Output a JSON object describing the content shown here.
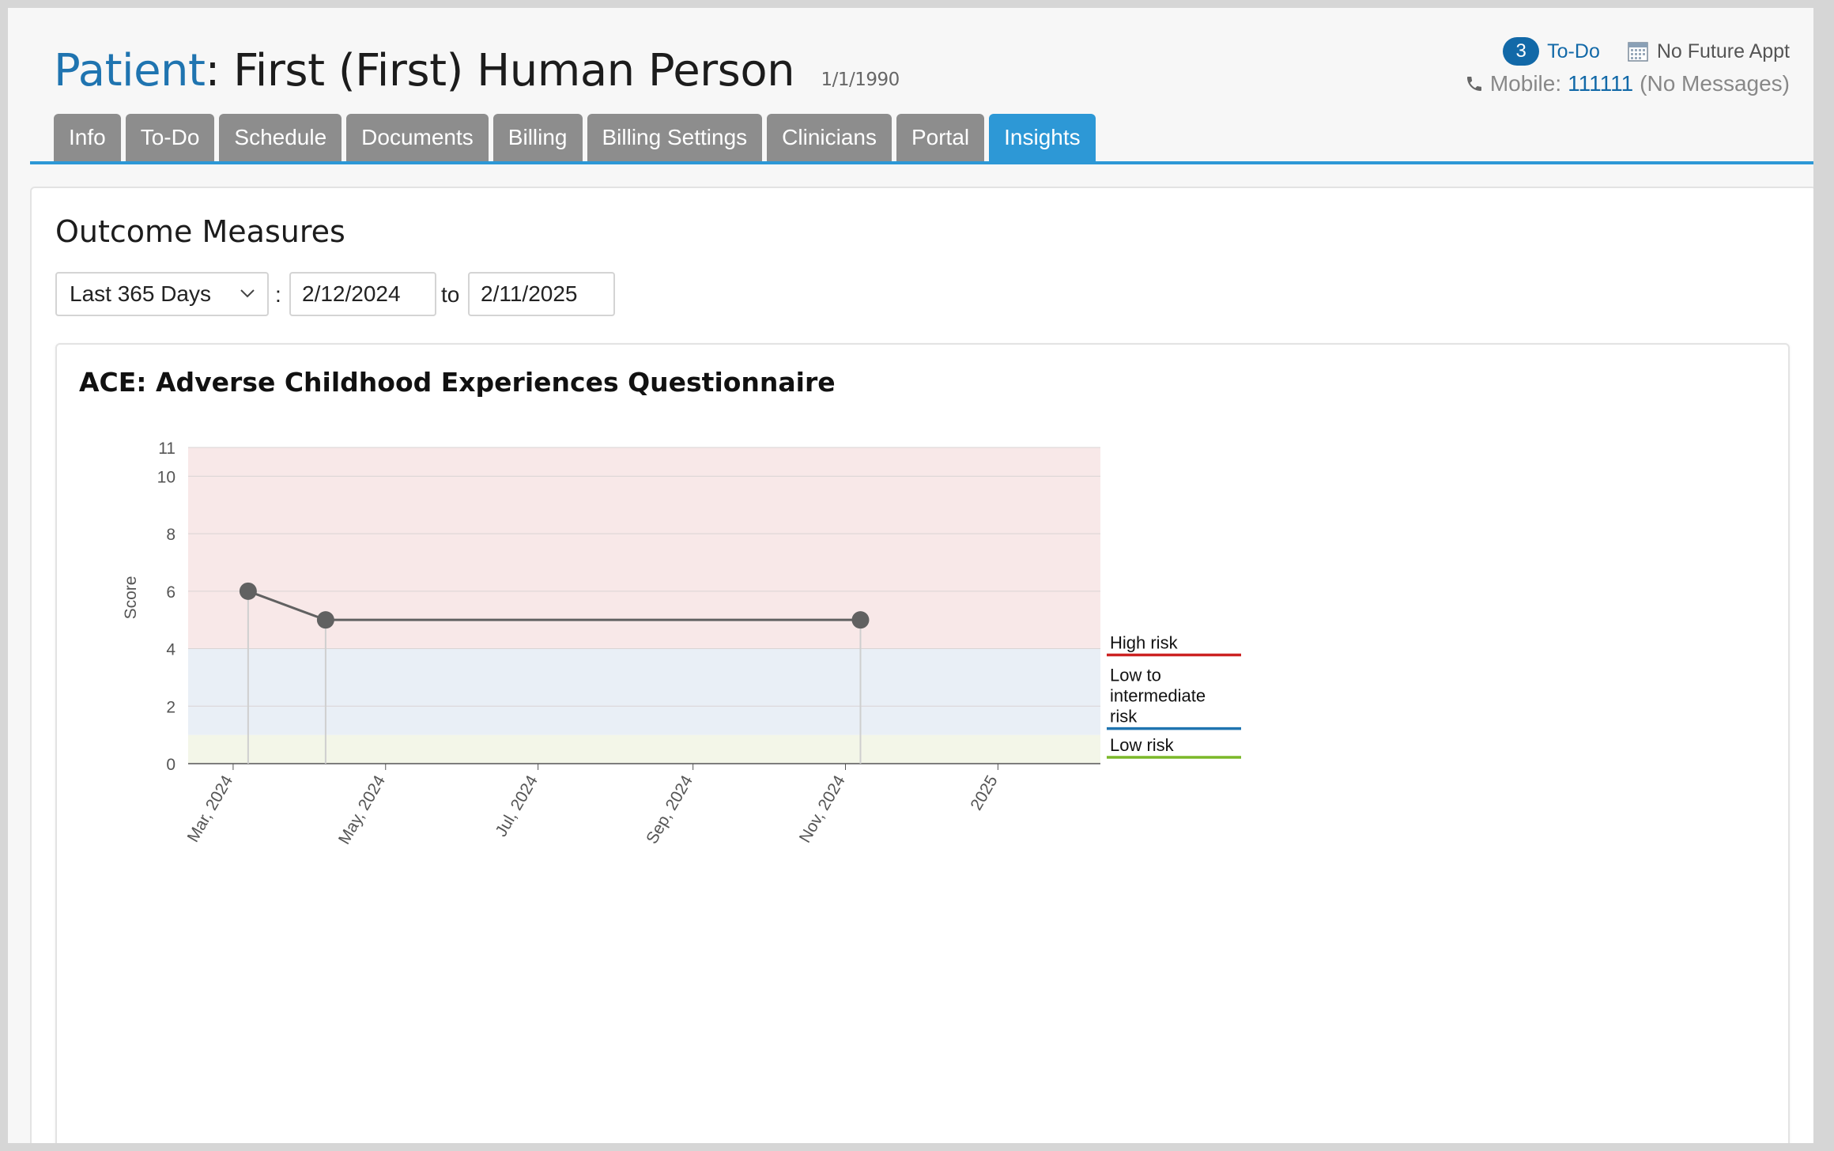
{
  "patient": {
    "label": "Patient",
    "colon": ": ",
    "name": "First (First) Human Person",
    "dob": "1/1/1990"
  },
  "header": {
    "todo_count": "3",
    "todo_label": "To-Do",
    "appointment": "No Future Appt",
    "mobile_label": "Mobile:",
    "mobile_number": "111111",
    "messages": "(No Messages)"
  },
  "tabs": [
    {
      "label": "Info"
    },
    {
      "label": "To-Do"
    },
    {
      "label": "Schedule"
    },
    {
      "label": "Documents"
    },
    {
      "label": "Billing"
    },
    {
      "label": "Billing Settings"
    },
    {
      "label": "Clinicians"
    },
    {
      "label": "Portal"
    },
    {
      "label": "Insights",
      "active": true
    }
  ],
  "outcome": {
    "title": "Outcome Measures",
    "range_selected": "Last 365 Days",
    "colon": ":",
    "from_date": "2/12/2024",
    "to_label": "to",
    "to_date": "2/11/2025"
  },
  "colors": {
    "accent": "#2d98d6",
    "link": "#1269a8",
    "high_risk": "#cc2222",
    "mid_risk": "#1f74b0",
    "low_risk": "#7bb829"
  },
  "chart_data": {
    "type": "line",
    "title": "ACE: Adverse Childhood Experiences Questionnaire",
    "ylabel": "Score",
    "xlabel": "",
    "ylim": [
      0,
      11
    ],
    "xlim": [
      "2024-02-12",
      "2025-02-11"
    ],
    "y_ticks": [
      0,
      2,
      4,
      6,
      8,
      10,
      11
    ],
    "x_ticks": [
      {
        "date": "2024-03-01",
        "label": "Mar, 2024"
      },
      {
        "date": "2024-05-01",
        "label": "May, 2024"
      },
      {
        "date": "2024-07-01",
        "label": "Jul, 2024"
      },
      {
        "date": "2024-09-01",
        "label": "Sep, 2024"
      },
      {
        "date": "2024-11-01",
        "label": "Nov, 2024"
      },
      {
        "date": "2025-01-01",
        "label": "2025"
      }
    ],
    "series": [
      {
        "points": [
          {
            "x": "2024-03-07",
            "y": 6
          },
          {
            "x": "2024-04-07",
            "y": 5
          },
          {
            "x": "2024-11-07",
            "y": 5
          }
        ]
      }
    ],
    "bands": [
      {
        "name": "Low risk",
        "from": 0,
        "to": 1,
        "fill": "#f3f6e8",
        "line": "#7bb829"
      },
      {
        "name": "Low to intermediate risk",
        "from": 1,
        "to": 4,
        "fill": "#e9eff6",
        "line": "#1f74b0"
      },
      {
        "name": "High risk",
        "from": 4,
        "to": 11,
        "fill": "#f8e8e8",
        "line": "#cc2222"
      }
    ],
    "legend_position": "right",
    "grid": true
  }
}
